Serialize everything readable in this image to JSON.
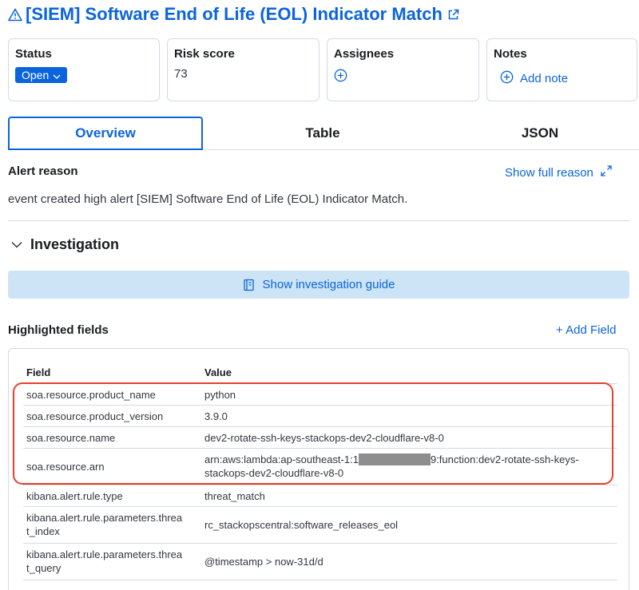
{
  "header": {
    "title": "[SIEM] Software End of Life (EOL) Indicator Match"
  },
  "cards": {
    "status": {
      "label": "Status",
      "value": "Open"
    },
    "risk": {
      "label": "Risk score",
      "value": "73"
    },
    "assignees": {
      "label": "Assignees"
    },
    "notes": {
      "label": "Notes",
      "add_label": "Add note"
    }
  },
  "tabs": [
    {
      "label": "Overview",
      "active": true
    },
    {
      "label": "Table",
      "active": false
    },
    {
      "label": "JSON",
      "active": false
    }
  ],
  "alert_reason": {
    "label": "Alert reason",
    "link": "Show full reason",
    "text": "event created high alert [SIEM] Software End of Life (EOL) Indicator Match."
  },
  "investigation": {
    "label": "Investigation",
    "guide_button": "Show investigation guide"
  },
  "highlighted": {
    "label": "Highlighted fields",
    "add_field": "+ Add Field",
    "col_field": "Field",
    "col_value": "Value",
    "rows": [
      {
        "field": "soa.resource.product_name",
        "value": "python"
      },
      {
        "field": "soa.resource.product_version",
        "value": "3.9.0"
      },
      {
        "field": "soa.resource.name",
        "value": "dev2-rotate-ssh-keys-stackops-dev2-cloudflare-v8-0"
      },
      {
        "field": "soa.resource.arn",
        "value_a": "arn:aws:lambda:ap-southeast-1:1",
        "value_b": "9:function:dev2-rotate-ssh-keys-",
        "value_c": "stackops-dev2-cloudflare-v8-0"
      },
      {
        "field": "kibana.alert.rule.type",
        "value": "threat_match"
      },
      {
        "field_a": "kibana.alert.rule.parameters.threa",
        "field_b": "t_index",
        "value": "rc_stackopscentral:software_releases_eol"
      },
      {
        "field_a": "kibana.alert.rule.parameters.threa",
        "field_b": "t_query",
        "value": "@timestamp > now-31d/d"
      }
    ]
  },
  "colors": {
    "accent": "#0b64dd",
    "highlight": "#e7402d",
    "guide_bg": "#cce4f5",
    "border": "#d3dae6"
  }
}
